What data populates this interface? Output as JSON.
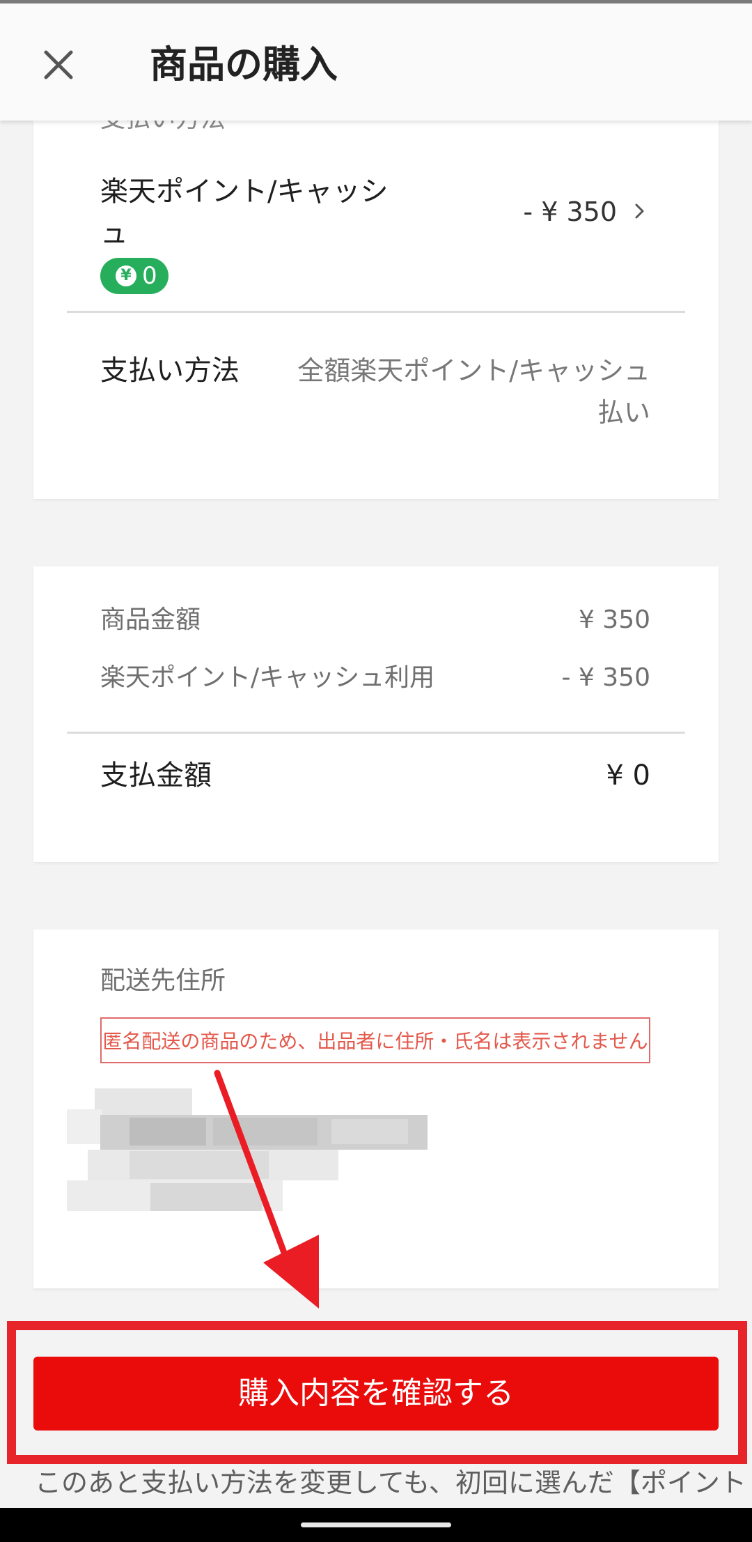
{
  "header": {
    "title": "商品の購入",
    "close_icon": "close-icon"
  },
  "payment": {
    "section_label_partial": "支払い方法",
    "points_name": "楽天ポイント/キャッシュ",
    "points_value": "- ¥ 350",
    "balance": "0",
    "balance_icon": "yen-icon",
    "method_label": "支払い方法",
    "method_value": "全額楽天ポイント/キャッシュ払い"
  },
  "summary": {
    "item_price_label": "商品金額",
    "item_price_value": "¥ 350",
    "points_used_label": "楽天ポイント/キャッシュ利用",
    "points_used_value": "- ¥ 350",
    "total_label": "支払金額",
    "total_value": "¥ 0"
  },
  "shipping": {
    "title": "配送先住所",
    "notice": "匿名配送の商品のため、出品者に住所・氏名は表示されません"
  },
  "cta": {
    "label": "購入内容を確認する"
  },
  "footnote": "このあと支払い方法を変更しても、初回に選んだ【ポイント",
  "colors": {
    "accent_red": "#ea0b0b",
    "highlight_red": "#e8242b",
    "badge_green": "#27ae5c",
    "notice_red": "#e4584b"
  }
}
